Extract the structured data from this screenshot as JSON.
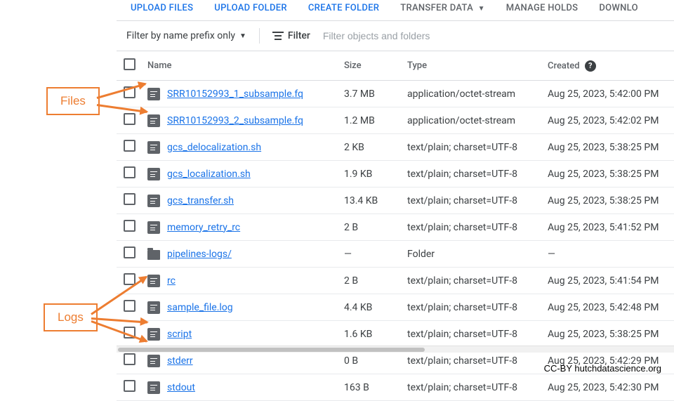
{
  "toolbar": {
    "upload_files": "UPLOAD FILES",
    "upload_folder": "UPLOAD FOLDER",
    "create_folder": "CREATE FOLDER",
    "transfer_data": "TRANSFER DATA",
    "manage_holds": "MANAGE HOLDS",
    "download": "DOWNLO"
  },
  "filterbar": {
    "prefix_label": "Filter by name prefix only",
    "filter_label": "Filter",
    "placeholder": "Filter objects and folders"
  },
  "columns": {
    "name": "Name",
    "size": "Size",
    "type": "Type",
    "created": "Created"
  },
  "rows": [
    {
      "icon": "file",
      "name": "SRR10152993_1_subsample.fq",
      "size": "3.7 MB",
      "type": "application/octet-stream",
      "created": "Aug 25, 2023, 5:42:00 PM"
    },
    {
      "icon": "file",
      "name": "SRR10152993_2_subsample.fq",
      "size": "1.2 MB",
      "type": "application/octet-stream",
      "created": "Aug 25, 2023, 5:42:02 PM"
    },
    {
      "icon": "file",
      "name": "gcs_delocalization.sh",
      "size": "2 KB",
      "type": "text/plain; charset=UTF-8",
      "created": "Aug 25, 2023, 5:38:25 PM"
    },
    {
      "icon": "file",
      "name": "gcs_localization.sh",
      "size": "1.9 KB",
      "type": "text/plain; charset=UTF-8",
      "created": "Aug 25, 2023, 5:38:25 PM"
    },
    {
      "icon": "file",
      "name": "gcs_transfer.sh",
      "size": "13.4 KB",
      "type": "text/plain; charset=UTF-8",
      "created": "Aug 25, 2023, 5:38:25 PM"
    },
    {
      "icon": "file",
      "name": "memory_retry_rc",
      "size": "2 B",
      "type": "text/plain; charset=UTF-8",
      "created": "Aug 25, 2023, 5:41:52 PM"
    },
    {
      "icon": "folder",
      "name": "pipelines-logs/",
      "size": "—",
      "type": "Folder",
      "created": "—"
    },
    {
      "icon": "file",
      "name": "rc",
      "size": "2 B",
      "type": "text/plain; charset=UTF-8",
      "created": "Aug 25, 2023, 5:41:54 PM"
    },
    {
      "icon": "file",
      "name": "sample_file.log",
      "size": "4.4 KB",
      "type": "text/plain; charset=UTF-8",
      "created": "Aug 25, 2023, 5:42:48 PM"
    },
    {
      "icon": "file",
      "name": "script",
      "size": "1.6 KB",
      "type": "text/plain; charset=UTF-8",
      "created": "Aug 25, 2023, 5:38:25 PM"
    },
    {
      "icon": "file",
      "name": "stderr",
      "size": "0 B",
      "type": "text/plain; charset=UTF-8",
      "created": "Aug 25, 2023, 5:42:29 PM"
    },
    {
      "icon": "file",
      "name": "stdout",
      "size": "163 B",
      "type": "text/plain; charset=UTF-8",
      "created": "Aug 25, 2023, 5:42:30 PM"
    }
  ],
  "annotations": {
    "files": "Files",
    "logs": "Logs"
  },
  "attribution": "CC-BY  hutchdatascience.org"
}
